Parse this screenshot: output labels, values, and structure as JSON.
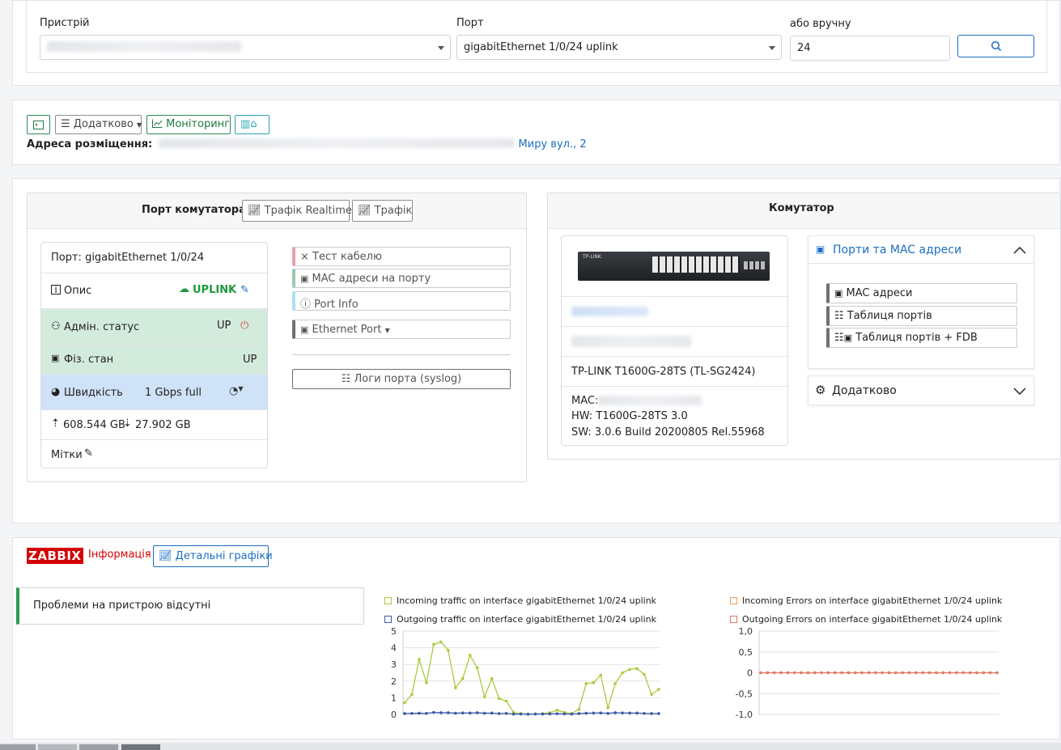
{
  "device_selector": {
    "device_label": "Пристрій",
    "port_label": "Порт",
    "port_value": "gigabitEthernet 1/0/24 uplink",
    "manual_label": "або вручну",
    "manual_value": "24",
    "search_icon": "search-icon"
  },
  "toolbar": {
    "terminal_icon": "terminal-icon",
    "extra_label": "Додатково",
    "monitoring_label": "Моніторинг",
    "map_icon": "map-icon",
    "address_label": "Адреса розміщення:",
    "address_link": "Миру вул., 2"
  },
  "port_panel": {
    "title": "Порт комутатора",
    "traffic_realtime_label": "Трафік Realtime",
    "traffic_label": "Трафік",
    "port_row": "Порт: gigabitEthernet 1/0/24",
    "desc_label": "Опис",
    "desc_value": "UPLINK",
    "admin_label": "Адмін. статус",
    "admin_value": "UP",
    "phys_label": "Фіз. стан",
    "phys_value": "UP",
    "speed_label": "Швидкість",
    "speed_value": "1 Gbps full",
    "upload": "608.544 GB",
    "download": "27.902 GB",
    "tags_label": "Мітки",
    "actions": {
      "cable_test": "Тест кабелю",
      "mac_on_port": "MAC адреси на порту",
      "port_info": "Port Info",
      "ethernet_port": "Ethernet Port",
      "port_logs": "Логи порта (syslog)"
    }
  },
  "switch_panel": {
    "title": "Комутатор",
    "model": "TP-LINK T1600G-28TS (TL-SG2424)",
    "mac_label": "MAC:",
    "hw": "HW: T1600G-28TS 3.0",
    "sw": "SW: 3.0.6 Build 20200805 Rel.55968",
    "ports_mac_title": "Порти та MAC адреси",
    "mac_addresses": "MAC адреси",
    "ports_table": "Таблиця портів",
    "ports_table_fdb": "Таблиця портів + FDB",
    "extra_title": "Додатково",
    "brand_on_device": "TP-LINK"
  },
  "zabbix": {
    "logo": "ZABBIX",
    "info_label": "Інформація",
    "detailed_graphs": "Детальні графіки",
    "no_problems": "Проблеми на пристрою відсутні"
  },
  "chart_data": [
    {
      "type": "line",
      "series": [
        {
          "name": "Incoming traffic on interface gigabitEthernet 1/0/24 uplink",
          "color": "#a8cc3c",
          "values": [
            0.7,
            1.2,
            3.3,
            1.9,
            4.2,
            4.35,
            3.85,
            1.6,
            2.15,
            3.55,
            2.8,
            1.05,
            2.15,
            0.95,
            0.8,
            0.12,
            0.05,
            0.02,
            0.03,
            0.05,
            0.1,
            0.25,
            0.12,
            0.05,
            0.3,
            1.85,
            1.9,
            2.35,
            0.4,
            1.85,
            2.5,
            2.7,
            2.75,
            2.4,
            1.2,
            1.5
          ]
        },
        {
          "name": "Outgoing traffic on interface gigabitEthernet 1/0/24 uplink",
          "color": "#3a5ba8",
          "values": [
            0.05,
            0.06,
            0.07,
            0.06,
            0.12,
            0.1,
            0.1,
            0.07,
            0.09,
            0.08,
            0.1,
            0.07,
            0.08,
            0.05,
            0.06,
            0.02,
            0.02,
            0.01,
            0.02,
            0.02,
            0.03,
            0.04,
            0.03,
            0.02,
            0.05,
            0.07,
            0.08,
            0.09,
            0.06,
            0.1,
            0.09,
            0.08,
            0.08,
            0.06,
            0.05,
            0.05
          ]
        }
      ],
      "yticks": [
        "5",
        "4",
        "3",
        "2",
        "1",
        "0"
      ],
      "ylim": [
        0,
        5
      ]
    },
    {
      "type": "line",
      "series": [
        {
          "name": "Incoming Errors on interface gigabitEthernet 1/0/24 uplink",
          "color": "#f0a060",
          "values": [
            0,
            0,
            0,
            0,
            0,
            0,
            0,
            0,
            0,
            0,
            0,
            0,
            0,
            0,
            0,
            0,
            0,
            0,
            0,
            0,
            0,
            0,
            0,
            0,
            0,
            0,
            0,
            0,
            0,
            0,
            0,
            0,
            0,
            0,
            0,
            0
          ]
        },
        {
          "name": "Outgoing Errors on interface gigabitEthernet 1/0/24 uplink",
          "color": "#e07a6a",
          "values": [
            0,
            0,
            0,
            0,
            0,
            0,
            0,
            0,
            0,
            0,
            0,
            0,
            0,
            0,
            0,
            0,
            0,
            0,
            0,
            0,
            0,
            0,
            0,
            0,
            0,
            0,
            0,
            0,
            0,
            0,
            0,
            0,
            0,
            0,
            0,
            0
          ]
        }
      ],
      "yticks": [
        "1,0",
        "0,5",
        "0",
        "-0,5",
        "-1,0"
      ],
      "ylim": [
        -1,
        1
      ]
    }
  ]
}
